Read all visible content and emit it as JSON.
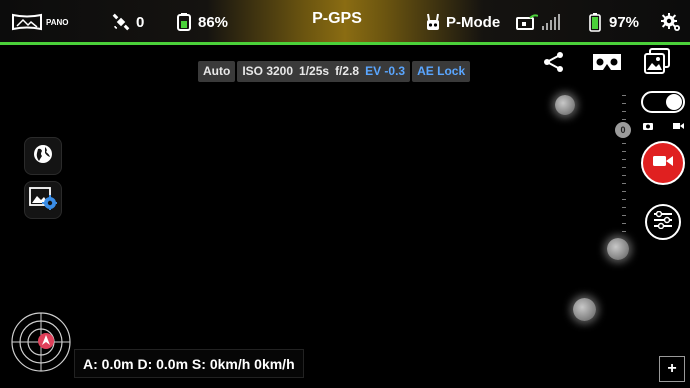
{
  "status_bar": {
    "pano_label": "PANO",
    "satellites": "0",
    "controller_battery": "86%",
    "flight_mode": "P-GPS",
    "rc_mode": "P-Mode",
    "aircraft_battery": "97%"
  },
  "camera_params": {
    "mode": "Auto",
    "iso": "ISO 3200",
    "shutter": "1/25s",
    "aperture": "f/2.8",
    "ev": "EV -0.3",
    "ae_lock": "AE Lock"
  },
  "zoom_label": "0",
  "telemetry": {
    "text": "A: 0.0m D: 0.0m S: 0km/h  0km/h"
  },
  "corner_button": "+",
  "colors": {
    "accent_green": "#4bd13a",
    "record_red": "#e02020",
    "ev_blue": "#5aa6ff"
  }
}
